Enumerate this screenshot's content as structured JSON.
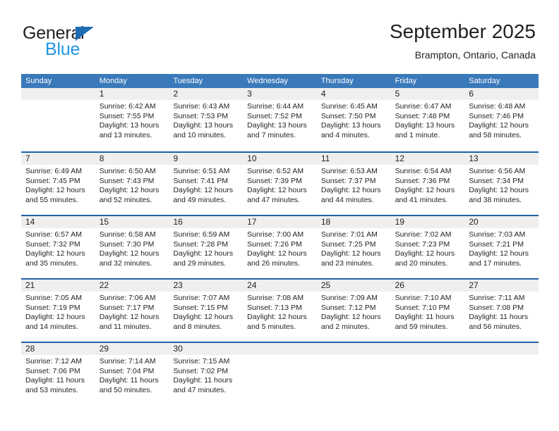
{
  "brand": {
    "name_primary": "General",
    "name_secondary": "Blue"
  },
  "header": {
    "title": "September 2025",
    "subtitle": "Brampton, Ontario, Canada"
  },
  "colors": {
    "header_blue": "#3a79ba",
    "row_divider_blue": "#1f63a8",
    "day_band_gray": "#efefef",
    "logo_blue": "#2196e3",
    "logo_triangle_blue": "#1f6cb4",
    "text": "#231f20"
  },
  "weekdays": [
    "Sunday",
    "Monday",
    "Tuesday",
    "Wednesday",
    "Thursday",
    "Friday",
    "Saturday"
  ],
  "weeks": [
    [
      {
        "day": "",
        "lines": [
          "",
          "",
          "",
          ""
        ],
        "empty": true
      },
      {
        "day": "1",
        "lines": [
          "Sunrise: 6:42 AM",
          "Sunset: 7:55 PM",
          "Daylight: 13 hours",
          "and 13 minutes."
        ]
      },
      {
        "day": "2",
        "lines": [
          "Sunrise: 6:43 AM",
          "Sunset: 7:53 PM",
          "Daylight: 13 hours",
          "and 10 minutes."
        ]
      },
      {
        "day": "3",
        "lines": [
          "Sunrise: 6:44 AM",
          "Sunset: 7:52 PM",
          "Daylight: 13 hours",
          "and 7 minutes."
        ]
      },
      {
        "day": "4",
        "lines": [
          "Sunrise: 6:45 AM",
          "Sunset: 7:50 PM",
          "Daylight: 13 hours",
          "and 4 minutes."
        ]
      },
      {
        "day": "5",
        "lines": [
          "Sunrise: 6:47 AM",
          "Sunset: 7:48 PM",
          "Daylight: 13 hours",
          "and 1 minute."
        ]
      },
      {
        "day": "6",
        "lines": [
          "Sunrise: 6:48 AM",
          "Sunset: 7:46 PM",
          "Daylight: 12 hours",
          "and 58 minutes."
        ]
      }
    ],
    [
      {
        "day": "7",
        "lines": [
          "Sunrise: 6:49 AM",
          "Sunset: 7:45 PM",
          "Daylight: 12 hours",
          "and 55 minutes."
        ]
      },
      {
        "day": "8",
        "lines": [
          "Sunrise: 6:50 AM",
          "Sunset: 7:43 PM",
          "Daylight: 12 hours",
          "and 52 minutes."
        ]
      },
      {
        "day": "9",
        "lines": [
          "Sunrise: 6:51 AM",
          "Sunset: 7:41 PM",
          "Daylight: 12 hours",
          "and 49 minutes."
        ]
      },
      {
        "day": "10",
        "lines": [
          "Sunrise: 6:52 AM",
          "Sunset: 7:39 PM",
          "Daylight: 12 hours",
          "and 47 minutes."
        ]
      },
      {
        "day": "11",
        "lines": [
          "Sunrise: 6:53 AM",
          "Sunset: 7:37 PM",
          "Daylight: 12 hours",
          "and 44 minutes."
        ]
      },
      {
        "day": "12",
        "lines": [
          "Sunrise: 6:54 AM",
          "Sunset: 7:36 PM",
          "Daylight: 12 hours",
          "and 41 minutes."
        ]
      },
      {
        "day": "13",
        "lines": [
          "Sunrise: 6:56 AM",
          "Sunset: 7:34 PM",
          "Daylight: 12 hours",
          "and 38 minutes."
        ]
      }
    ],
    [
      {
        "day": "14",
        "lines": [
          "Sunrise: 6:57 AM",
          "Sunset: 7:32 PM",
          "Daylight: 12 hours",
          "and 35 minutes."
        ]
      },
      {
        "day": "15",
        "lines": [
          "Sunrise: 6:58 AM",
          "Sunset: 7:30 PM",
          "Daylight: 12 hours",
          "and 32 minutes."
        ]
      },
      {
        "day": "16",
        "lines": [
          "Sunrise: 6:59 AM",
          "Sunset: 7:28 PM",
          "Daylight: 12 hours",
          "and 29 minutes."
        ]
      },
      {
        "day": "17",
        "lines": [
          "Sunrise: 7:00 AM",
          "Sunset: 7:26 PM",
          "Daylight: 12 hours",
          "and 26 minutes."
        ]
      },
      {
        "day": "18",
        "lines": [
          "Sunrise: 7:01 AM",
          "Sunset: 7:25 PM",
          "Daylight: 12 hours",
          "and 23 minutes."
        ]
      },
      {
        "day": "19",
        "lines": [
          "Sunrise: 7:02 AM",
          "Sunset: 7:23 PM",
          "Daylight: 12 hours",
          "and 20 minutes."
        ]
      },
      {
        "day": "20",
        "lines": [
          "Sunrise: 7:03 AM",
          "Sunset: 7:21 PM",
          "Daylight: 12 hours",
          "and 17 minutes."
        ]
      }
    ],
    [
      {
        "day": "21",
        "lines": [
          "Sunrise: 7:05 AM",
          "Sunset: 7:19 PM",
          "Daylight: 12 hours",
          "and 14 minutes."
        ]
      },
      {
        "day": "22",
        "lines": [
          "Sunrise: 7:06 AM",
          "Sunset: 7:17 PM",
          "Daylight: 12 hours",
          "and 11 minutes."
        ]
      },
      {
        "day": "23",
        "lines": [
          "Sunrise: 7:07 AM",
          "Sunset: 7:15 PM",
          "Daylight: 12 hours",
          "and 8 minutes."
        ]
      },
      {
        "day": "24",
        "lines": [
          "Sunrise: 7:08 AM",
          "Sunset: 7:13 PM",
          "Daylight: 12 hours",
          "and 5 minutes."
        ]
      },
      {
        "day": "25",
        "lines": [
          "Sunrise: 7:09 AM",
          "Sunset: 7:12 PM",
          "Daylight: 12 hours",
          "and 2 minutes."
        ]
      },
      {
        "day": "26",
        "lines": [
          "Sunrise: 7:10 AM",
          "Sunset: 7:10 PM",
          "Daylight: 11 hours",
          "and 59 minutes."
        ]
      },
      {
        "day": "27",
        "lines": [
          "Sunrise: 7:11 AM",
          "Sunset: 7:08 PM",
          "Daylight: 11 hours",
          "and 56 minutes."
        ]
      }
    ],
    [
      {
        "day": "28",
        "lines": [
          "Sunrise: 7:12 AM",
          "Sunset: 7:06 PM",
          "Daylight: 11 hours",
          "and 53 minutes."
        ]
      },
      {
        "day": "29",
        "lines": [
          "Sunrise: 7:14 AM",
          "Sunset: 7:04 PM",
          "Daylight: 11 hours",
          "and 50 minutes."
        ]
      },
      {
        "day": "30",
        "lines": [
          "Sunrise: 7:15 AM",
          "Sunset: 7:02 PM",
          "Daylight: 11 hours",
          "and 47 minutes."
        ]
      },
      {
        "day": "",
        "lines": [
          "",
          "",
          "",
          ""
        ],
        "empty": true
      },
      {
        "day": "",
        "lines": [
          "",
          "",
          "",
          ""
        ],
        "empty": true
      },
      {
        "day": "",
        "lines": [
          "",
          "",
          "",
          ""
        ],
        "empty": true
      },
      {
        "day": "",
        "lines": [
          "",
          "",
          "",
          ""
        ],
        "empty": true
      }
    ]
  ]
}
